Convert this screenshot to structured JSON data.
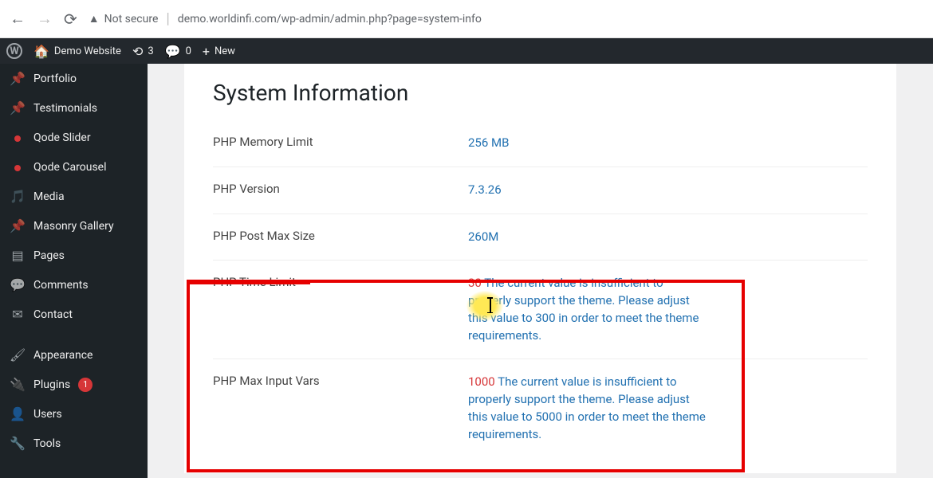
{
  "browser": {
    "not_secure": "Not secure",
    "url": "demo.worldinfi.com/wp-admin/admin.php?page=system-info"
  },
  "adminbar": {
    "site_name": "Demo Website",
    "updates": "3",
    "comments": "0",
    "new": "New"
  },
  "sidebar": {
    "items": [
      {
        "icon": "pin",
        "label": "Portfolio"
      },
      {
        "icon": "pin",
        "label": "Testimonials"
      },
      {
        "icon": "reddot",
        "label": "Qode Slider"
      },
      {
        "icon": "reddot",
        "label": "Qode Carousel"
      },
      {
        "icon": "media",
        "label": "Media"
      },
      {
        "icon": "pin",
        "label": "Masonry Gallery"
      },
      {
        "icon": "page",
        "label": "Pages"
      },
      {
        "icon": "comment",
        "label": "Comments"
      },
      {
        "icon": "mail",
        "label": "Contact"
      },
      {
        "icon": "brush",
        "label": "Appearance"
      },
      {
        "icon": "plug",
        "label": "Plugins",
        "badge": "1"
      },
      {
        "icon": "user",
        "label": "Users"
      },
      {
        "icon": "wrench",
        "label": "Tools"
      }
    ]
  },
  "content": {
    "title": "System Information",
    "rows": [
      {
        "label": "PHP Memory Limit",
        "value": "256 MB"
      },
      {
        "label": "PHP Version",
        "value": "7.3.26"
      },
      {
        "label": "PHP Post Max Size",
        "value": "260M"
      },
      {
        "label": "PHP Time Limit",
        "warn_num": "30",
        "warn_text": " The current value is insufficient to properly support the theme. Please adjust this value to 300 in order to meet the theme requirements."
      },
      {
        "label": "PHP Max Input Vars",
        "warn_num": "1000",
        "warn_text": " The current value is insufficient to properly support the theme. Please adjust this value to 5000 in order to meet the theme requirements."
      }
    ]
  }
}
